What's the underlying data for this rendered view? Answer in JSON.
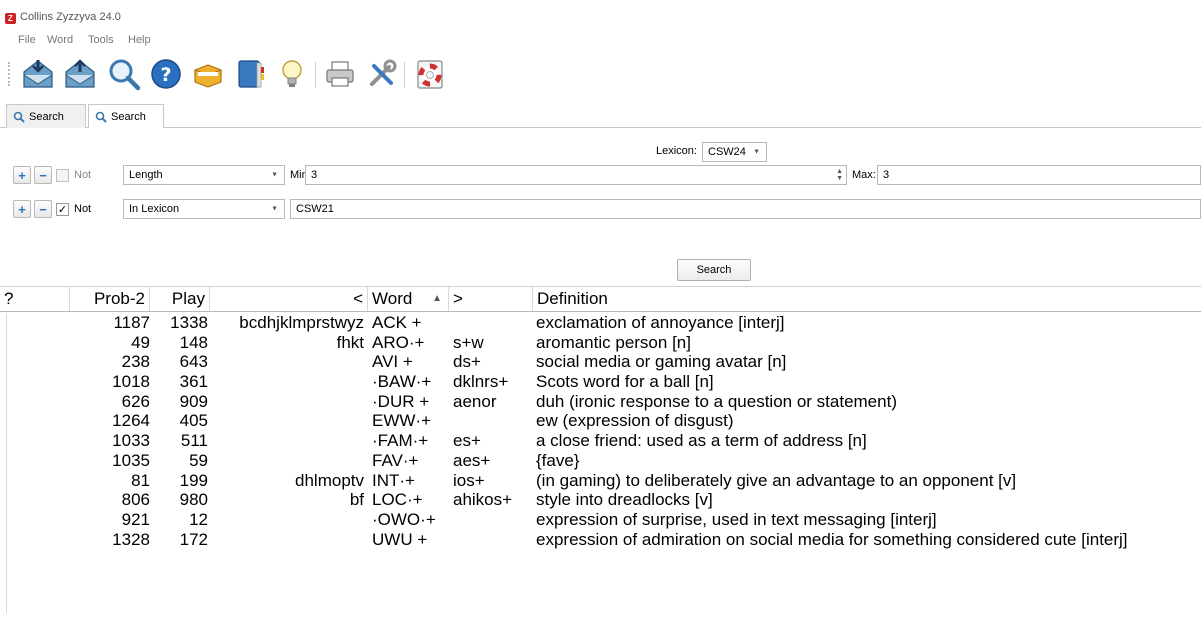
{
  "window": {
    "title": "Collins Zyzzyva 24.0",
    "icon_letter": "Z",
    "icon_color": "#cc2222"
  },
  "menu": [
    "File",
    "Word",
    "Tools",
    "Help"
  ],
  "toolbar": {
    "icons": [
      "new-search-icon",
      "new-quiz-icon",
      "search-icon",
      "help-icon",
      "cardbox-icon",
      "book-icon",
      "lightbulb-icon",
      "print-icon",
      "tools-icon",
      "lifebuoy-icon"
    ]
  },
  "tabs": [
    {
      "label": "Search",
      "active": false
    },
    {
      "label": "Search",
      "active": true
    }
  ],
  "search_panel": {
    "lexicon_label": "Lexicon:",
    "lexicon_value": "CSW24",
    "conditions": [
      {
        "not_label": "Not",
        "not_checked": false,
        "type": "Length",
        "min_label": "Min:",
        "min_value": "3",
        "max_label": "Max:",
        "max_value": "3"
      },
      {
        "not_label": "Not",
        "not_checked": true,
        "type": "In Lexicon",
        "value": "CSW21"
      }
    ],
    "search_button": "Search"
  },
  "results": {
    "headers": [
      "?",
      "Prob-2",
      "Play",
      "<",
      "Word",
      ">",
      "Definition"
    ],
    "rows": [
      {
        "prob": "1187",
        "play": "1338",
        "front": "bcdhjklmprstwyz",
        "word": "ACK +",
        "back": "",
        "def": "exclamation of annoyance [interj]"
      },
      {
        "prob": "49",
        "play": "148",
        "front": "fhkt",
        "word": "ARO·+",
        "back": "s+w",
        "def": "aromantic person [n]"
      },
      {
        "prob": "238",
        "play": "643",
        "front": "",
        "word": "AVI +",
        "back": "ds+",
        "def": "social media or gaming avatar [n]"
      },
      {
        "prob": "1018",
        "play": "361",
        "front": "",
        "word": "·BAW·+",
        "back": "dklnrs+",
        "def": "Scots word for a ball [n]"
      },
      {
        "prob": "626",
        "play": "909",
        "front": "",
        "word": "·DUR +",
        "back": "aenor",
        "def": "duh (ironic response to a question or statement)"
      },
      {
        "prob": "1264",
        "play": "405",
        "front": "",
        "word": "EWW·+",
        "back": "",
        "def": "ew (expression of disgust)"
      },
      {
        "prob": "1033",
        "play": "511",
        "front": "",
        "word": "·FAM·+",
        "back": "es+",
        "def": "a close friend: used as a term of address [n]"
      },
      {
        "prob": "1035",
        "play": "59",
        "front": "",
        "word": "FAV·+",
        "back": "aes+",
        "def": "{fave}"
      },
      {
        "prob": "81",
        "play": "199",
        "front": "dhlmoptv",
        "word": "INT·+",
        "back": "ios+",
        "def": "(in gaming) to deliberately give an advantage to an opponent [v]"
      },
      {
        "prob": "806",
        "play": "980",
        "front": "bf",
        "word": "LOC·+",
        "back": "ahikos+",
        "def": "style into dreadlocks [v]"
      },
      {
        "prob": "921",
        "play": "12",
        "front": "",
        "word": "·OWO·+",
        "back": "",
        "def": "expression of surprise, used in text messaging [interj]"
      },
      {
        "prob": "1328",
        "play": "172",
        "front": "",
        "word": "UWU +",
        "back": "",
        "def": "expression of admiration on social media for something considered cute [interj]"
      }
    ]
  }
}
